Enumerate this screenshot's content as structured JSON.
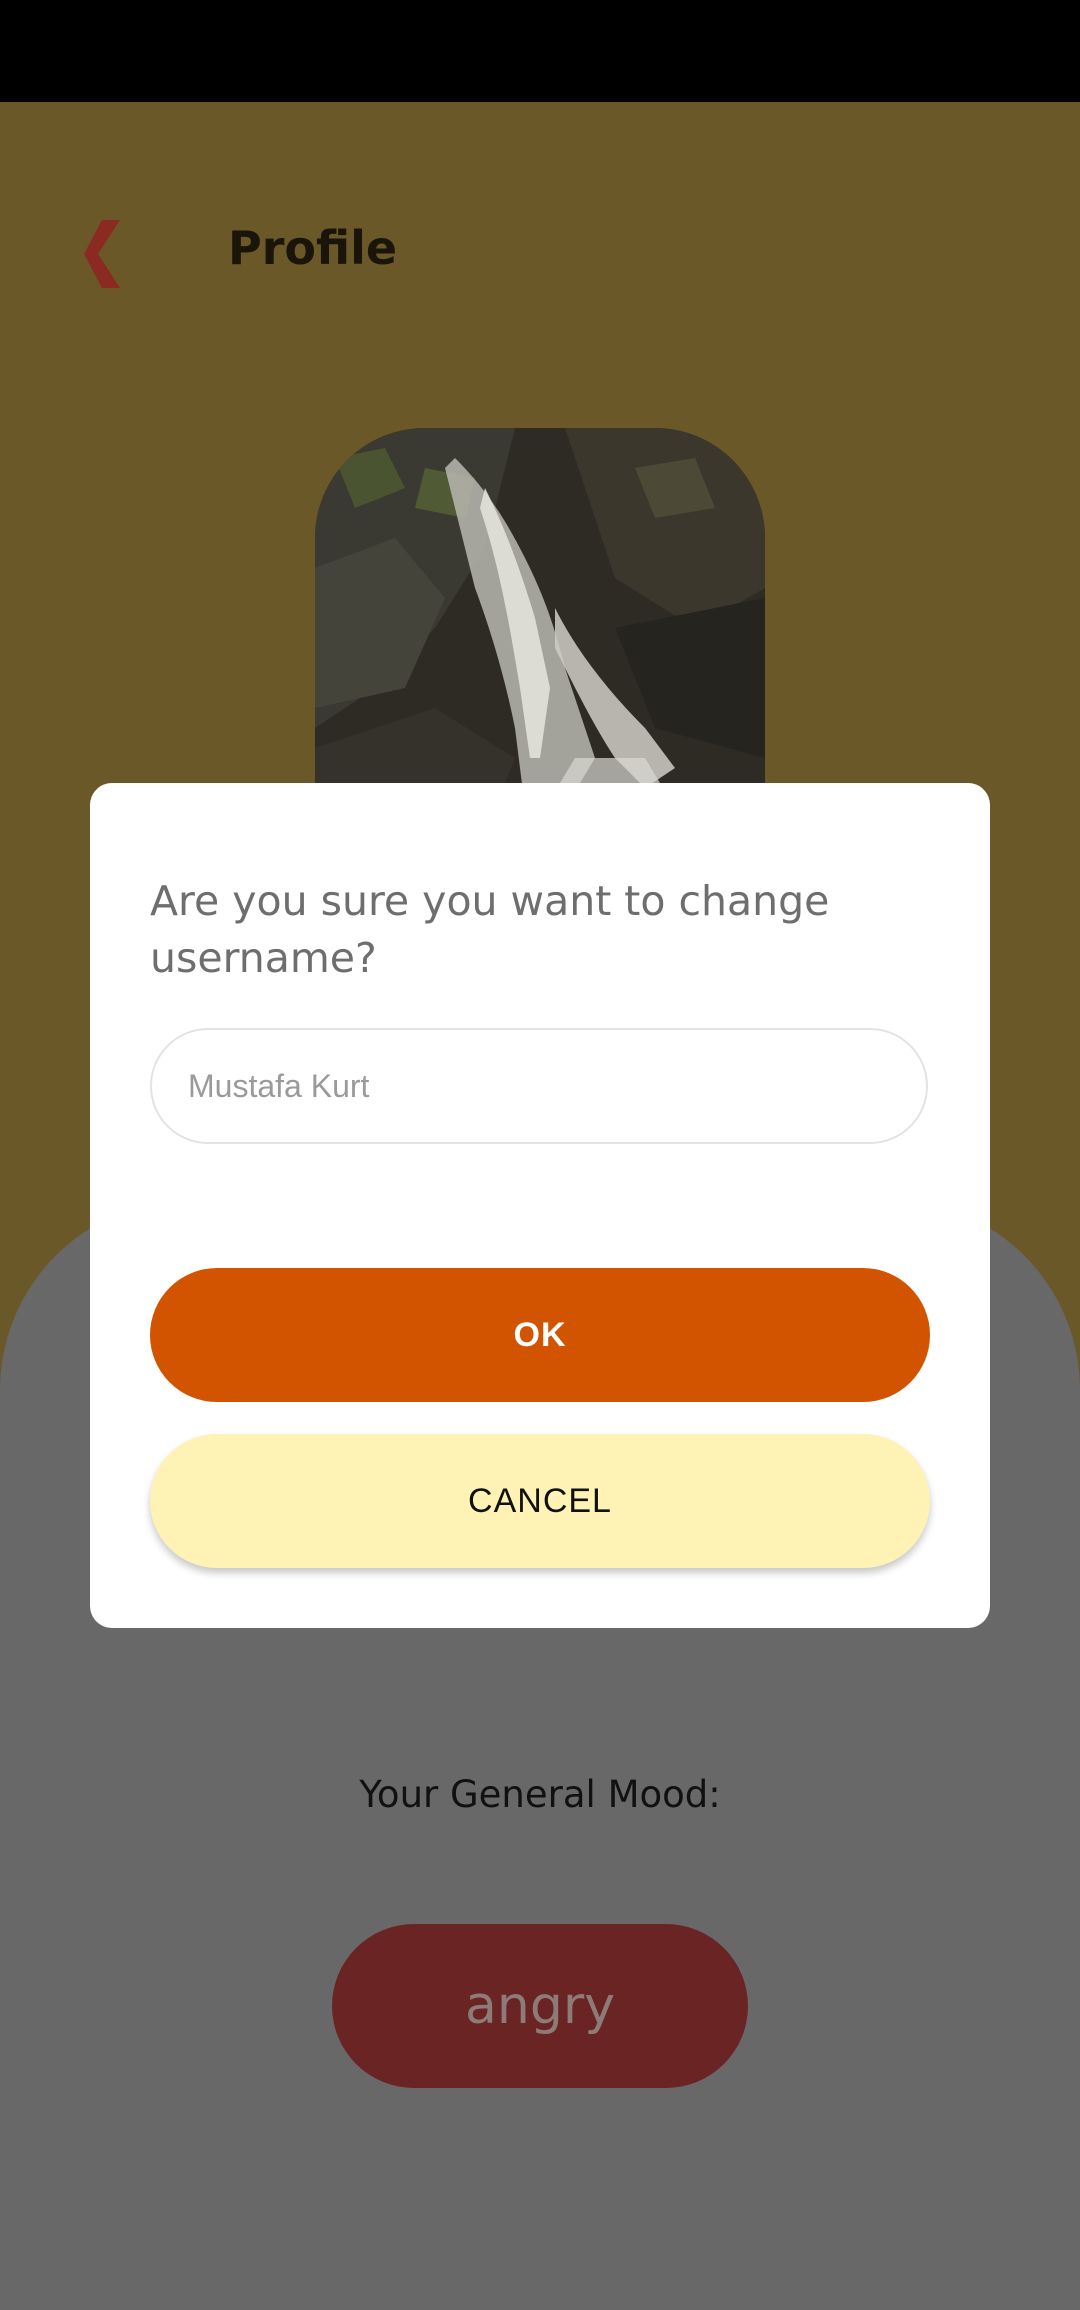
{
  "header": {
    "title": "Profile",
    "back_icon": "chevron-left-icon",
    "back_color": "#8b2a20"
  },
  "profile": {
    "avatar_description_icon": "waterfall-photo"
  },
  "mood": {
    "label": "Your General Mood:",
    "value": "angry",
    "pill_color": "#6b2424"
  },
  "dialog": {
    "message": "Are you sure you want to change username?",
    "input": {
      "value": "",
      "placeholder": "Mustafa Kurt"
    },
    "ok_label": "OK",
    "cancel_label": "CANCEL"
  },
  "colors": {
    "status_bar": "#000000",
    "header_bg_dimmed": "#6a5829",
    "sheet_dimmed": "#686868",
    "ok_button": "#d35400",
    "cancel_button": "#fef2b5"
  }
}
